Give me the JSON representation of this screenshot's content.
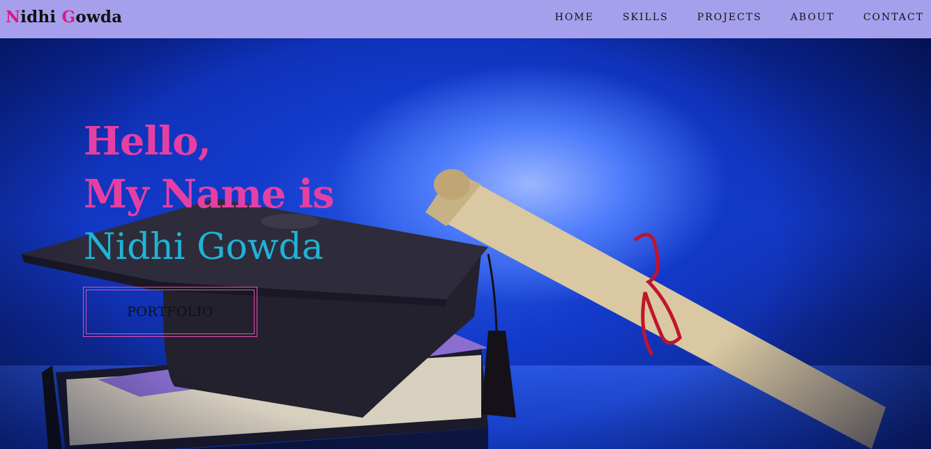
{
  "brand": {
    "first_initial": "N",
    "first_rest": "idhi ",
    "last_initial": "G",
    "last_rest": "owda",
    "highlight_color": "#e0168c"
  },
  "nav": {
    "items": [
      "HOME",
      "SKILLS",
      "PROJECTS",
      "ABOUT",
      "CONTACT"
    ],
    "background_color": "#a6a0ec"
  },
  "hero": {
    "line1": "Hello,",
    "line2": "My Name is",
    "line3": "Nidhi Gowda",
    "greeting_color": "#e63fa3",
    "name_color": "#1fb3d6",
    "button_label": "PORTFOLIO",
    "background_image": "graduation-cap-diploma-books-photo"
  }
}
